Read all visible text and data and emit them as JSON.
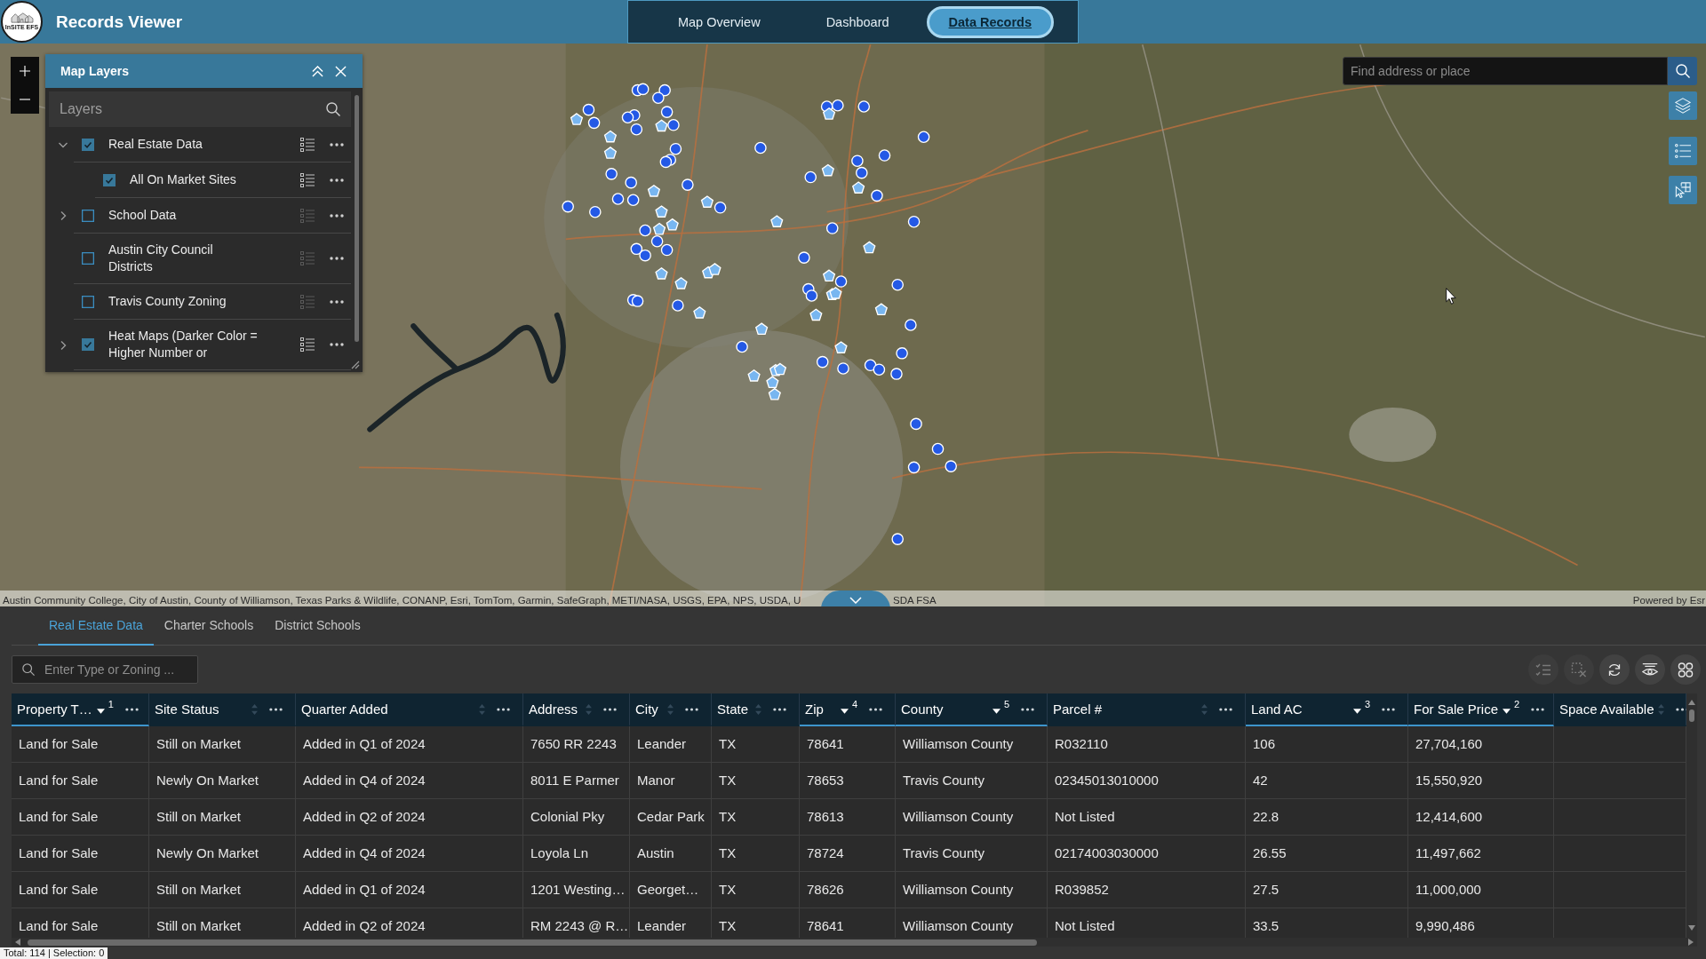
{
  "header": {
    "logo_text": "InSITE EFS",
    "title": "Records Viewer",
    "nav": [
      {
        "label": "Map Overview",
        "selected": false
      },
      {
        "label": "Dashboard",
        "selected": false
      },
      {
        "label": "Data Records",
        "selected": true
      }
    ]
  },
  "map": {
    "search": {
      "placeholder": "Find address or place"
    },
    "layers_panel": {
      "title": "Map Layers",
      "heading": "Layers",
      "layers": [
        {
          "kind": "group",
          "label": "Real Estate Data",
          "checked": true,
          "expanded": true,
          "children": [
            {
              "kind": "layer",
              "label": "All On Market Sites",
              "checked": true
            }
          ]
        },
        {
          "kind": "group",
          "label": "School Data",
          "checked": false,
          "expanded": false
        },
        {
          "kind": "layer",
          "label": "Austin City Council Districts",
          "checked": false
        },
        {
          "kind": "layer",
          "label": "Travis County Zoning",
          "checked": false
        },
        {
          "kind": "group",
          "label": "Heat Maps (Darker Color = Higher Number or",
          "checked": true,
          "expanded": false
        }
      ]
    },
    "attribution": {
      "text": "Austin Community College, City of Austin, County of Williamson, Texas Parks & Wildlife, CONANP, Esri, TomTom, Garmin, SafeGraph, METI/NASA, USGS, EPA, NPS, USDA, U",
      "text_after": "SDA FSA",
      "powered_by": "Powered by Esr"
    }
  },
  "table_panel": {
    "tabs": [
      {
        "label": "Real Estate Data",
        "selected": true
      },
      {
        "label": "Charter Schools",
        "selected": false
      },
      {
        "label": "District Schools",
        "selected": false
      }
    ],
    "search": {
      "placeholder": "Enter Type or Zoning ..."
    },
    "actions": [
      {
        "kind": "show-selected",
        "disabled": true
      },
      {
        "kind": "clear-selection",
        "disabled": true
      },
      {
        "kind": "refresh",
        "disabled": false
      },
      {
        "kind": "toggle-columns",
        "disabled": false
      },
      {
        "kind": "layout",
        "disabled": false
      }
    ],
    "table": {
      "columns": [
        {
          "label": "Property T…",
          "sorted": true,
          "descending": true,
          "sort_rank": "1"
        },
        {
          "label": "Site Status",
          "sorted": false
        },
        {
          "label": "Quarter Added",
          "sorted": false
        },
        {
          "label": "Address",
          "sorted": false
        },
        {
          "label": "City",
          "sorted": false
        },
        {
          "label": "State",
          "sorted": false
        },
        {
          "label": "Zip",
          "sorted": true,
          "descending": true,
          "sort_rank": "4"
        },
        {
          "label": "County",
          "sorted": true,
          "descending": true,
          "sort_rank": "5"
        },
        {
          "label": "Parcel #",
          "sorted": false
        },
        {
          "label": "Land AC",
          "sorted": true,
          "descending": true,
          "sort_rank": "3"
        },
        {
          "label": "For Sale Price",
          "sorted": true,
          "descending": true,
          "sort_rank": "2"
        },
        {
          "label": "Space Available",
          "sorted": false
        }
      ],
      "rows": [
        [
          "Land for Sale",
          "Still on Market",
          "Added in Q1 of 2024",
          "7650 RR 2243",
          "Leander",
          "TX",
          "78641",
          "Williamson County",
          "R032110",
          "106",
          "27,704,160"
        ],
        [
          "Land for Sale",
          "Newly On Market",
          "Added in Q4 of 2024",
          "8011 E Parmer",
          "Manor",
          "TX",
          "78653",
          "Travis County",
          "02345013010000",
          "42",
          "15,550,920"
        ],
        [
          "Land for Sale",
          "Still on Market",
          "Added in Q2 of 2024",
          "Colonial Pky",
          "Cedar Park",
          "TX",
          "78613",
          "Williamson County",
          "Not Listed",
          "22.8",
          "12,414,600"
        ],
        [
          "Land for Sale",
          "Newly On Market",
          "Added in Q4 of 2024",
          "Loyola Ln",
          "Austin",
          "TX",
          "78724",
          "Travis County",
          "02174003030000",
          "26.55",
          "11,497,662"
        ],
        [
          "Land for Sale",
          "Still on Market",
          "Added in Q1 of 2024",
          "1201 Westing…",
          "Georget…",
          "TX",
          "78626",
          "Williamson County",
          "R039852",
          "27.5",
          "11,000,000"
        ],
        [
          "Land for Sale",
          "Still on Market",
          "Added in Q2 of 2024",
          "RM 2243 @ R…",
          "Leander",
          "TX",
          "78641",
          "Williamson County",
          "Not Listed",
          "33.5",
          "9,990,486"
        ]
      ]
    },
    "status_bar": "Total: 114 | Selection: 0"
  }
}
